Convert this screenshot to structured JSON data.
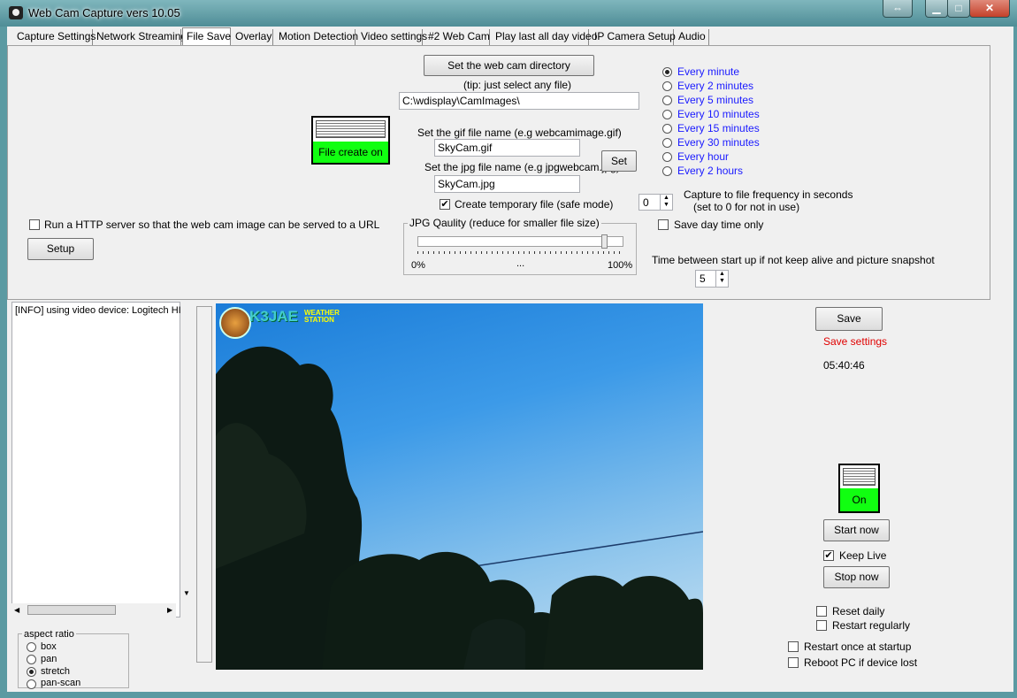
{
  "window": {
    "title": "Web Cam Capture vers 10.05"
  },
  "tabs": [
    {
      "label": "Capture Settings"
    },
    {
      "label": "Network Streaming"
    },
    {
      "label": "File Save"
    },
    {
      "label": "Overlay"
    },
    {
      "label": "Motion Detection"
    },
    {
      "label": "Video settings"
    },
    {
      "label": "#2 Web Cam"
    },
    {
      "label": "Play last all day video"
    },
    {
      "label": "IP Camera Setup"
    },
    {
      "label": "Audio"
    }
  ],
  "file_save": {
    "set_dir_label": "Set the web cam directory",
    "tip": "(tip: just select any file)",
    "directory": "C:\\wdisplay\\CamImages\\",
    "file_create_label": "File create on",
    "gif_label": "Set the gif file name (e.g webcamimage.gif)",
    "gif_value": "SkyCam.gif",
    "jpg_label": "Set the jpg file name (e.g jpgwebcam.jpg)",
    "jpg_value": "SkyCam.jpg",
    "set_label": "Set",
    "temp_label": "Create temporary file (safe mode)",
    "temp_checked": true,
    "jpg_quality_title": "JPG Qaulity  (reduce for smaller file size)",
    "jpg_quality_min": "0%",
    "jpg_quality_mid": "...",
    "jpg_quality_max": "100%",
    "jpg_quality_value": 0.95,
    "http_label": "Run a HTTP server so that the web cam image can be served to a URL",
    "setup_label": "Setup",
    "intervals": [
      {
        "label": "Every minute",
        "selected": true
      },
      {
        "label": "Every 2 minutes",
        "selected": false
      },
      {
        "label": "Every 5 minutes",
        "selected": false
      },
      {
        "label": "Every 10 minutes",
        "selected": false
      },
      {
        "label": "Every 15 minutes",
        "selected": false
      },
      {
        "label": "Every 30 minutes",
        "selected": false
      },
      {
        "label": "Every hour",
        "selected": false
      },
      {
        "label": "Every 2 hours",
        "selected": false
      }
    ],
    "freq_value": "0",
    "freq_label_1": "Capture to file frequency in seconds",
    "freq_label_2": "(set to 0 for not in use)",
    "daytime_label": "Save day time only",
    "keepalive_label": "Time between start up if not keep alive and picture snapshot",
    "keepalive_value": "5"
  },
  "log": {
    "line1": "[INFO] using video device: Logitech HI"
  },
  "aspect": {
    "title": "aspect ratio",
    "options": [
      {
        "label": "box",
        "selected": false
      },
      {
        "label": "pan",
        "selected": false
      },
      {
        "label": "stretch",
        "selected": true
      },
      {
        "label": "pan-scan",
        "selected": false
      }
    ]
  },
  "camera": {
    "logo_text": "K3JAE",
    "logo_sub": "WEATHER STATION"
  },
  "right_panel": {
    "save_label": "Save",
    "save_settings": "Save settings",
    "clock": "05:40:46",
    "on_label": "On",
    "start_now": "Start now",
    "keep_live": "Keep Live",
    "stop_now": "Stop now",
    "reset_daily": "Reset daily",
    "restart_regularly": "Restart regularly",
    "restart_startup": "Restart once at startup",
    "reboot_pc": "Reboot PC if device lost"
  },
  "colors": {
    "toggle_green": "#11ff11",
    "save_settings_red": "#e00000",
    "radio_blue": "#1a1aff"
  }
}
